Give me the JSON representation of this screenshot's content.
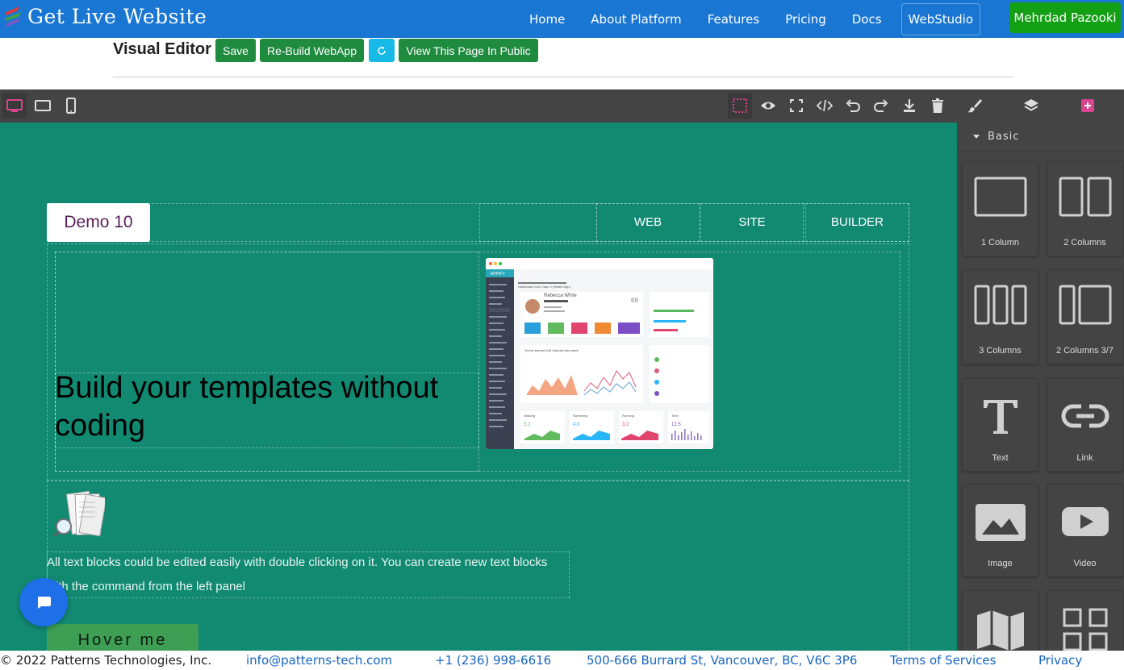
{
  "brand": {
    "name": "Get Live Website"
  },
  "nav": {
    "links": [
      "Home",
      "About Platform",
      "Features",
      "Pricing",
      "Docs",
      "WebStudio"
    ],
    "user": "Mehrdad Pazooki"
  },
  "editor": {
    "title": "Visual Editor",
    "buttons": {
      "save": "Save",
      "rebuild": "Re-Build WebApp",
      "view_public": "View This Page In Public"
    }
  },
  "toolbar": {
    "devices": [
      "desktop-icon",
      "tablet-icon",
      "mobile-icon"
    ],
    "actions": [
      "select-outline-icon",
      "preview-eye-icon",
      "fullscreen-icon",
      "code-icon",
      "undo-icon",
      "redo-icon",
      "download-icon",
      "trash-icon"
    ],
    "panels": [
      "brush-icon",
      "layers-icon",
      "plus-square-icon"
    ]
  },
  "canvas": {
    "demo_label": "Demo 10",
    "menu": [
      "WEB",
      "SITE",
      "BUILDER"
    ],
    "hero_text": "Build your templates without coding",
    "mockup": {
      "app_name": "APPIFY",
      "page_title": "Dashboard Use Case 3 (Health App)",
      "user_name": "Rebecca White",
      "metric": "68",
      "section_title": "You've burned 445 Calories this week",
      "cards": [
        "Walking",
        "Swimming",
        "Running",
        "Time"
      ],
      "card_values": [
        "5.2",
        "4.9",
        "3.2",
        "12.5"
      ]
    },
    "body_text": "All text blocks could be edited easily with double clicking on it. You can create new text blocks with the command from the left panel",
    "hover_button": "Hover me"
  },
  "blocks": {
    "category": "Basic",
    "items": [
      "1 Column",
      "2 Columns",
      "3 Columns",
      "2 Columns 3/7",
      "Text",
      "Link",
      "Image",
      "Video"
    ]
  },
  "footer": {
    "copyright": "© 2022 Patterns Technologies, Inc.",
    "email": "info@patterns-tech.com",
    "phone": "+1 (236) 998-6616",
    "address": "500-666 Burrard St, Vancouver, BC, V6C 3P6",
    "terms": "Terms of Services",
    "privacy": "Privacy"
  },
  "colors": {
    "navbar": "#1976d2",
    "canvas_bg": "#128a72",
    "editor_panel": "#444444",
    "user_button": "#14a014",
    "action_button": "#1f8b3f",
    "refresh_button": "#17b9e6",
    "chat_bubble": "#1f6fe8",
    "link": "#1565c0"
  }
}
